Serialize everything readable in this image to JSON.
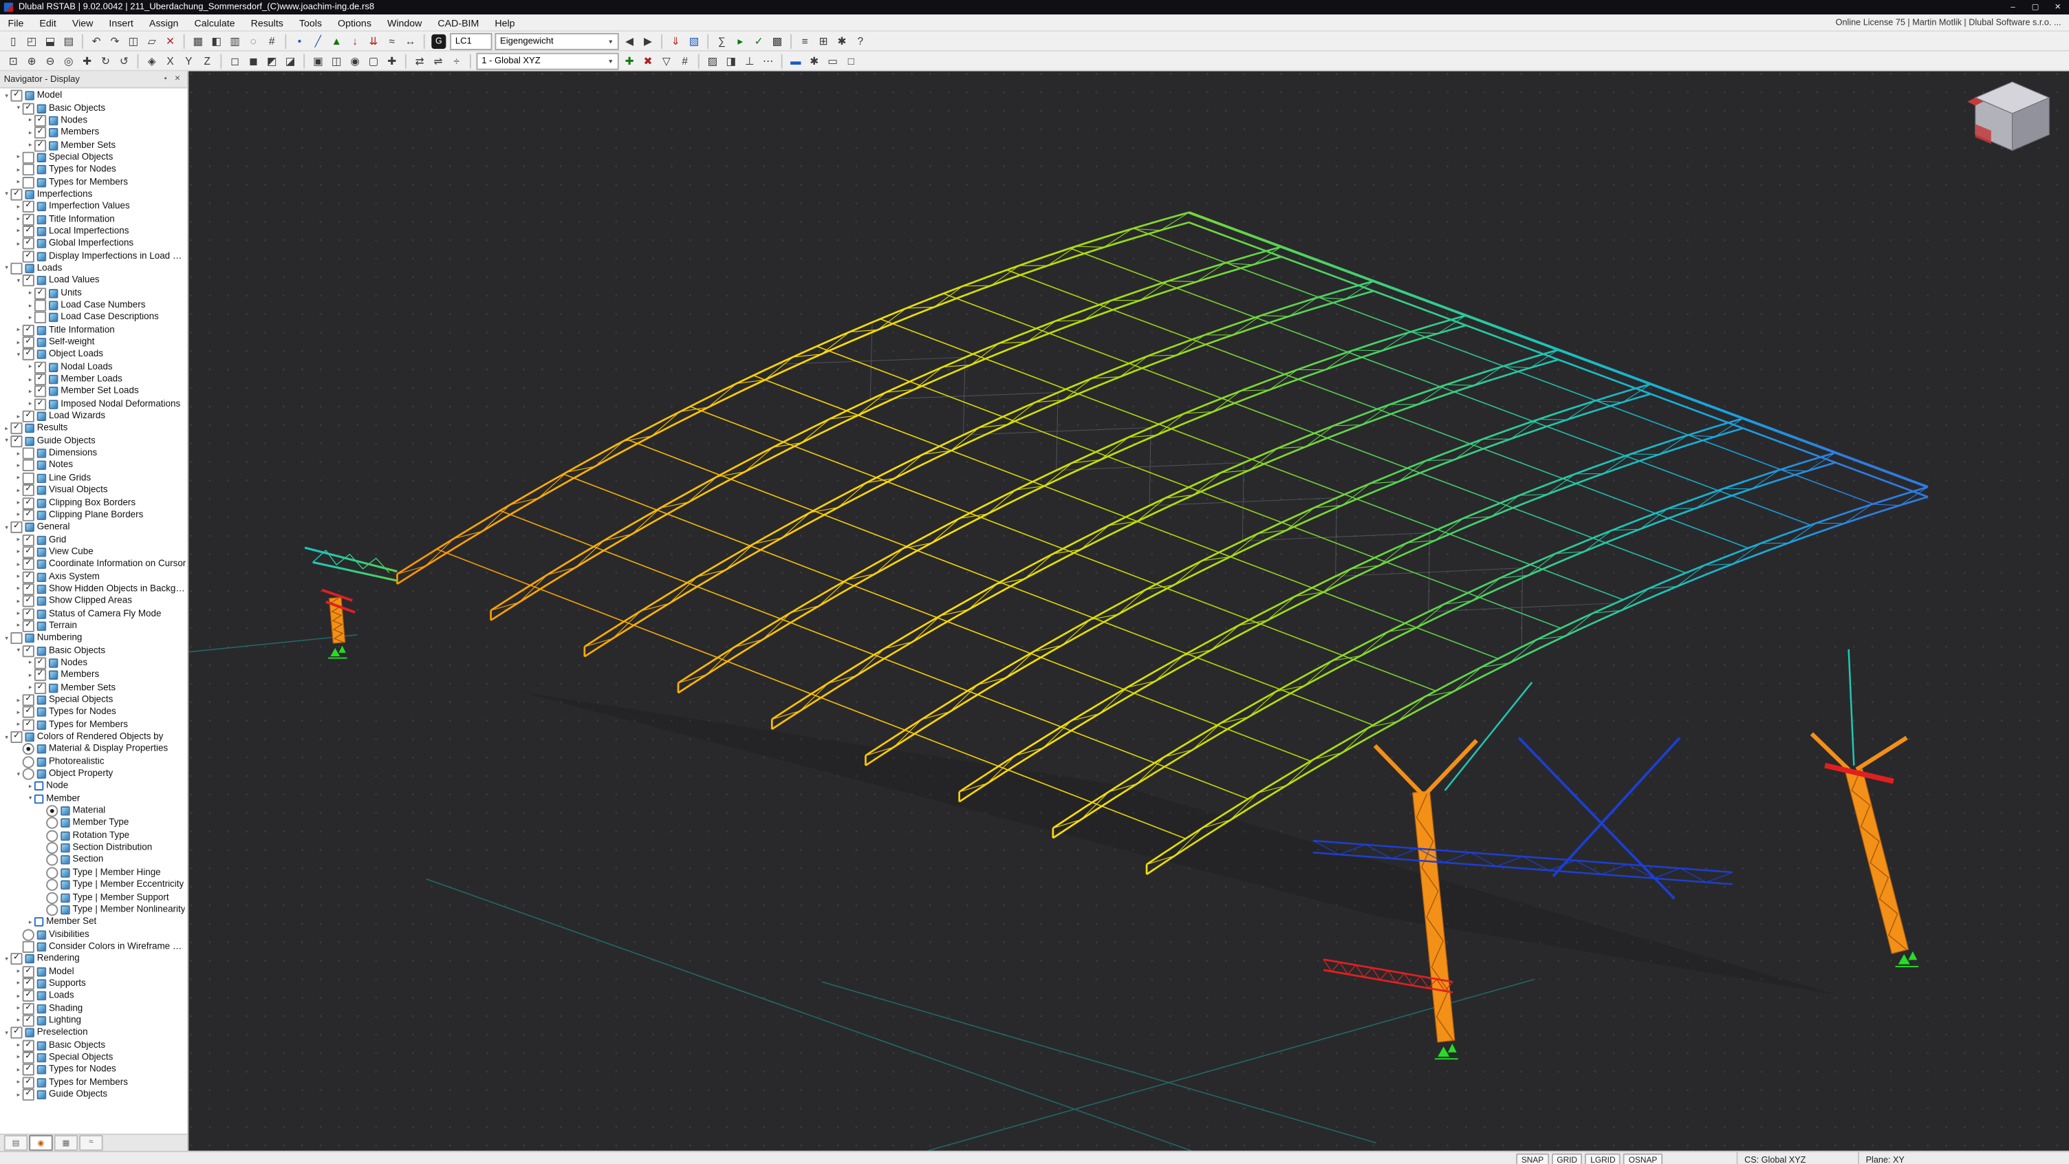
{
  "window": {
    "title": "Dlubal RSTAB | 9.02.0042 | 211_Überdachung_Sommersdorf_(C)www.joachim-ing.de.rs8",
    "controls": [
      {
        "name": "minimize-button",
        "glyph": "–"
      },
      {
        "name": "maximize-button",
        "glyph": "▢"
      },
      {
        "name": "close-button",
        "glyph": "✕"
      }
    ]
  },
  "menu": {
    "items": [
      "File",
      "Edit",
      "View",
      "Insert",
      "Assign",
      "Calculate",
      "Results",
      "Tools",
      "Options",
      "Window",
      "CAD-BIM",
      "Help"
    ],
    "license": "Online License 75 | Martin Motlik | Dlubal Software s.r.o. ..."
  },
  "toolbar1": {
    "icons_left": [
      {
        "n": "new-model-icon",
        "g": "▯"
      },
      {
        "n": "open-model-icon",
        "g": "◰"
      },
      {
        "n": "save-model-icon",
        "g": "⬓"
      },
      {
        "n": "print-icon",
        "g": "▤"
      },
      {
        "sep": true
      },
      {
        "n": "undo-icon",
        "g": "↶"
      },
      {
        "n": "redo-icon",
        "g": "↷"
      },
      {
        "n": "copy-icon",
        "g": "◫"
      },
      {
        "n": "paste-icon",
        "g": "▱"
      },
      {
        "n": "delete-icon",
        "g": "✕",
        "c": "#a82222"
      },
      {
        "sep": true
      },
      {
        "n": "edit-tables-icon",
        "g": "▦"
      },
      {
        "n": "navigator-toggle-icon",
        "g": "◧"
      },
      {
        "n": "tables-toggle-icon",
        "g": "▥"
      },
      {
        "n": "find-icon",
        "g": "◌"
      },
      {
        "n": "renumber-icon",
        "g": "#"
      },
      {
        "sep": true
      },
      {
        "n": "new-node-icon",
        "g": "•",
        "c": "#1a5ac8"
      },
      {
        "n": "new-member-icon",
        "g": "╱",
        "c": "#1a5ac8"
      },
      {
        "n": "new-support-icon",
        "g": "▲",
        "c": "#127812"
      },
      {
        "n": "new-nodal-load-icon",
        "g": "↓",
        "c": "#c01818"
      },
      {
        "n": "new-member-load-icon",
        "g": "⇊",
        "c": "#c01818"
      },
      {
        "n": "imperfection-icon",
        "g": "≈"
      },
      {
        "n": "dimension-icon",
        "g": "↔"
      },
      {
        "sep": true
      }
    ],
    "case_badge": "G",
    "case_number": "LC1",
    "case_description": "Eigengewicht",
    "chevron": "▼",
    "icons_right": [
      {
        "n": "previous-load-case-icon",
        "g": "◀"
      },
      {
        "n": "next-load-case-icon",
        "g": "▶"
      },
      {
        "sep": true
      },
      {
        "n": "show-loads-icon",
        "g": "⇓",
        "c": "#c01818"
      },
      {
        "n": "show-results-icon",
        "g": "▧",
        "c": "#1a5ac8"
      },
      {
        "sep": true
      },
      {
        "n": "calculate-all-icon",
        "g": "∑"
      },
      {
        "n": "run-calculation-icon",
        "g": "▸",
        "c": "#0a7a0a"
      },
      {
        "n": "check-model-icon",
        "g": "✓",
        "c": "#0a7a0a"
      },
      {
        "n": "mesh-icon",
        "g": "▩"
      },
      {
        "sep": true
      },
      {
        "n": "printout-report-icon",
        "g": "≡"
      },
      {
        "n": "export-icon",
        "g": "⊞"
      },
      {
        "n": "units-settings-icon",
        "g": "✱"
      },
      {
        "n": "help-icon",
        "g": "?"
      }
    ]
  },
  "toolbar2": {
    "icons_left": [
      {
        "n": "zoom-window-icon",
        "g": "⊡"
      },
      {
        "n": "zoom-in-icon",
        "g": "⊕"
      },
      {
        "n": "zoom-out-icon",
        "g": "⊖"
      },
      {
        "n": "zoom-all-icon",
        "g": "◎"
      },
      {
        "n": "pan-view-icon",
        "g": "✚"
      },
      {
        "n": "rotate-view-icon",
        "g": "↻"
      },
      {
        "n": "previous-view-icon",
        "g": "↺"
      },
      {
        "sep": true
      },
      {
        "n": "isometric-view-icon",
        "g": "◈"
      },
      {
        "n": "view-in-x-icon",
        "g": "X"
      },
      {
        "n": "view-in-y-icon",
        "g": "Y"
      },
      {
        "n": "view-in-z-icon",
        "g": "Z"
      },
      {
        "sep": true
      },
      {
        "n": "wireframe-display-icon",
        "g": "◻"
      },
      {
        "n": "solid-display-icon",
        "g": "◼"
      },
      {
        "n": "transparent-display-icon",
        "g": "◩"
      },
      {
        "n": "hidden-line-display-icon",
        "g": "◪"
      },
      {
        "sep": true
      },
      {
        "n": "clipping-box-icon",
        "g": "▣"
      },
      {
        "n": "clipping-plane-icon",
        "g": "◫"
      },
      {
        "n": "visibility-mode-icon",
        "g": "◉"
      },
      {
        "n": "select-objects-icon",
        "g": "▢"
      },
      {
        "n": "special-selection-icon",
        "g": "✚"
      },
      {
        "sep": true
      },
      {
        "n": "move-copy-icon",
        "g": "⇄"
      },
      {
        "n": "mirror-objects-icon",
        "g": "⇌"
      },
      {
        "n": "divide-member-icon",
        "g": "÷"
      },
      {
        "sep": true
      }
    ],
    "view_selector": "1 - Global XYZ",
    "chevron": "▼",
    "icons_right": [
      {
        "n": "new-visibility-icon",
        "g": "✚",
        "c": "#0a7a0a"
      },
      {
        "n": "cancel-selection-icon",
        "g": "✖",
        "c": "#a82222"
      },
      {
        "n": "filter-icon",
        "g": "▽"
      },
      {
        "n": "numbering-toggle-icon",
        "g": "#"
      },
      {
        "sep": true
      },
      {
        "n": "display-properties-icon",
        "g": "▨"
      },
      {
        "n": "background-icon",
        "g": "◨"
      },
      {
        "n": "axis-systems-icon",
        "g": "⊥"
      },
      {
        "n": "grid-settings-icon",
        "g": "⋯"
      },
      {
        "sep": true
      },
      {
        "n": "render-mode-icon",
        "g": "▬",
        "c": "#1a5ac8"
      },
      {
        "n": "light-settings-icon",
        "g": "✱"
      },
      {
        "n": "screenshot-icon",
        "g": "▭"
      },
      {
        "n": "full-screen-icon",
        "g": "□"
      }
    ]
  },
  "navigator": {
    "title": "Navigator - Display",
    "header_icons": [
      {
        "name": "dock-pin-icon",
        "glyph": "▪"
      },
      {
        "name": "close-navigator-icon",
        "glyph": "✕"
      }
    ],
    "items": [
      {
        "label": "Model",
        "depth": 0,
        "ctrl": "cb",
        "on": true,
        "exp": "o"
      },
      {
        "label": "Basic Objects",
        "depth": 1,
        "ctrl": "cb",
        "on": true,
        "exp": "o"
      },
      {
        "label": "Nodes",
        "depth": 2,
        "ctrl": "cb",
        "on": true,
        "exp": "c"
      },
      {
        "label": "Members",
        "depth": 2,
        "ctrl": "cb",
        "on": true,
        "exp": "c"
      },
      {
        "label": "Member Sets",
        "depth": 2,
        "ctrl": "cb",
        "on": true,
        "exp": "c"
      },
      {
        "label": "Special Objects",
        "depth": 1,
        "ctrl": "cb",
        "on": false,
        "exp": "c"
      },
      {
        "label": "Types for Nodes",
        "depth": 1,
        "ctrl": "cb",
        "on": false,
        "exp": "c"
      },
      {
        "label": "Types for Members",
        "depth": 1,
        "ctrl": "cb",
        "on": false,
        "exp": "c"
      },
      {
        "label": "Imperfections",
        "depth": 0,
        "ctrl": "cb",
        "on": true,
        "exp": "o"
      },
      {
        "label": "Imperfection Values",
        "depth": 1,
        "ctrl": "cb",
        "on": true,
        "exp": "c"
      },
      {
        "label": "Title Information",
        "depth": 1,
        "ctrl": "cb",
        "on": true,
        "exp": "c"
      },
      {
        "label": "Local Imperfections",
        "depth": 1,
        "ctrl": "cb",
        "on": true,
        "exp": "c"
      },
      {
        "label": "Global Imperfections",
        "depth": 1,
        "ctrl": "cb",
        "on": true,
        "exp": "c"
      },
      {
        "label": "Display Imperfections in Load Cas...",
        "depth": 1,
        "ctrl": "cb",
        "on": true,
        "exp": "-"
      },
      {
        "label": "Loads",
        "depth": 0,
        "ctrl": "cb",
        "on": false,
        "exp": "o"
      },
      {
        "label": "Load Values",
        "depth": 1,
        "ctrl": "cb",
        "on": true,
        "exp": "o"
      },
      {
        "label": "Units",
        "depth": 2,
        "ctrl": "cb",
        "on": true,
        "exp": "c"
      },
      {
        "label": "Load Case Numbers",
        "depth": 2,
        "ctrl": "cb",
        "on": false,
        "exp": "c"
      },
      {
        "label": "Load Case Descriptions",
        "depth": 2,
        "ctrl": "cb",
        "on": false,
        "exp": "c"
      },
      {
        "label": "Title Information",
        "depth": 1,
        "ctrl": "cb",
        "on": true,
        "exp": "c"
      },
      {
        "label": "Self-weight",
        "depth": 1,
        "ctrl": "cb",
        "on": true,
        "exp": "c"
      },
      {
        "label": "Object Loads",
        "depth": 1,
        "ctrl": "cb",
        "on": true,
        "exp": "o"
      },
      {
        "label": "Nodal Loads",
        "depth": 2,
        "ctrl": "cb",
        "on": true,
        "exp": "c"
      },
      {
        "label": "Member Loads",
        "depth": 2,
        "ctrl": "cb",
        "on": true,
        "exp": "c"
      },
      {
        "label": "Member Set Loads",
        "depth": 2,
        "ctrl": "cb",
        "on": true,
        "exp": "c"
      },
      {
        "label": "Imposed Nodal Deformations",
        "depth": 2,
        "ctrl": "cb",
        "on": true,
        "exp": "c"
      },
      {
        "label": "Load Wizards",
        "depth": 1,
        "ctrl": "cb",
        "on": true,
        "exp": "c"
      },
      {
        "label": "Results",
        "depth": 0,
        "ctrl": "cb",
        "on": true,
        "exp": "c"
      },
      {
        "label": "Guide Objects",
        "depth": 0,
        "ctrl": "cb",
        "on": true,
        "exp": "o"
      },
      {
        "label": "Dimensions",
        "depth": 1,
        "ctrl": "cb",
        "on": false,
        "exp": "c"
      },
      {
        "label": "Notes",
        "depth": 1,
        "ctrl": "cb",
        "on": false,
        "exp": "c"
      },
      {
        "label": "Line Grids",
        "depth": 1,
        "ctrl": "cb",
        "on": false,
        "exp": "c"
      },
      {
        "label": "Visual Objects",
        "depth": 1,
        "ctrl": "cb",
        "on": true,
        "exp": "c"
      },
      {
        "label": "Clipping Box Borders",
        "depth": 1,
        "ctrl": "cb",
        "on": true,
        "exp": "c"
      },
      {
        "label": "Clipping Plane Borders",
        "depth": 1,
        "ctrl": "cb",
        "on": true,
        "exp": "c"
      },
      {
        "label": "General",
        "depth": 0,
        "ctrl": "cb",
        "on": true,
        "exp": "o"
      },
      {
        "label": "Grid",
        "depth": 1,
        "ctrl": "cb",
        "on": true,
        "exp": "c"
      },
      {
        "label": "View Cube",
        "depth": 1,
        "ctrl": "cb",
        "on": true,
        "exp": "c"
      },
      {
        "label": "Coordinate Information on Cursor",
        "depth": 1,
        "ctrl": "cb",
        "on": true,
        "exp": "c"
      },
      {
        "label": "Axis System",
        "depth": 1,
        "ctrl": "cb",
        "on": true,
        "exp": "c"
      },
      {
        "label": "Show Hidden Objects in Backgro...",
        "depth": 1,
        "ctrl": "cb",
        "on": true,
        "exp": "c"
      },
      {
        "label": "Show Clipped Areas",
        "depth": 1,
        "ctrl": "cb",
        "on": true,
        "exp": "c"
      },
      {
        "label": "Status of Camera Fly Mode",
        "depth": 1,
        "ctrl": "cb",
        "on": true,
        "exp": "c"
      },
      {
        "label": "Terrain",
        "depth": 1,
        "ctrl": "cb",
        "on": true,
        "exp": "c"
      },
      {
        "label": "Numbering",
        "depth": 0,
        "ctrl": "cb",
        "on": false,
        "exp": "o"
      },
      {
        "label": "Basic Objects",
        "depth": 1,
        "ctrl": "cb",
        "on": true,
        "exp": "o"
      },
      {
        "label": "Nodes",
        "depth": 2,
        "ctrl": "cb",
        "on": true,
        "exp": "c"
      },
      {
        "label": "Members",
        "depth": 2,
        "ctrl": "cb",
        "on": true,
        "exp": "c"
      },
      {
        "label": "Member Sets",
        "depth": 2,
        "ctrl": "cb",
        "on": true,
        "exp": "c"
      },
      {
        "label": "Special Objects",
        "depth": 1,
        "ctrl": "cb",
        "on": true,
        "exp": "c"
      },
      {
        "label": "Types for Nodes",
        "depth": 1,
        "ctrl": "cb",
        "on": true,
        "exp": "c"
      },
      {
        "label": "Types for Members",
        "depth": 1,
        "ctrl": "cb",
        "on": true,
        "exp": "c"
      },
      {
        "label": "Colors of Rendered Objects by",
        "depth": 0,
        "ctrl": "cb",
        "on": true,
        "exp": "o"
      },
      {
        "label": "Material & Display Properties",
        "depth": 1,
        "ctrl": "rb",
        "on": true,
        "exp": "-"
      },
      {
        "label": "Photorealistic",
        "depth": 1,
        "ctrl": "rb",
        "on": false,
        "exp": "-"
      },
      {
        "label": "Object Property",
        "depth": 1,
        "ctrl": "rb",
        "on": false,
        "exp": "o"
      },
      {
        "label": "Node",
        "depth": 2,
        "ctrl": "none",
        "on": false,
        "exp": "c",
        "swatch": true
      },
      {
        "label": "Member",
        "depth": 2,
        "ctrl": "none",
        "on": false,
        "exp": "o",
        "swatch": true
      },
      {
        "label": "Material",
        "depth": 3,
        "ctrl": "rb",
        "on": true,
        "exp": "-"
      },
      {
        "label": "Member Type",
        "depth": 3,
        "ctrl": "rb",
        "on": false,
        "exp": "-"
      },
      {
        "label": "Rotation Type",
        "depth": 3,
        "ctrl": "rb",
        "on": false,
        "exp": "-"
      },
      {
        "label": "Section Distribution",
        "depth": 3,
        "ctrl": "rb",
        "on": false,
        "exp": "-"
      },
      {
        "label": "Section",
        "depth": 3,
        "ctrl": "rb",
        "on": false,
        "exp": "-"
      },
      {
        "label": "Type | Member Hinge",
        "depth": 3,
        "ctrl": "rb",
        "on": false,
        "exp": "-"
      },
      {
        "label": "Type | Member Eccentricity",
        "depth": 3,
        "ctrl": "rb",
        "on": false,
        "exp": "-"
      },
      {
        "label": "Type | Member Support",
        "depth": 3,
        "ctrl": "rb",
        "on": false,
        "exp": "-"
      },
      {
        "label": "Type | Member Nonlinearity",
        "depth": 3,
        "ctrl": "rb",
        "on": false,
        "exp": "-"
      },
      {
        "label": "Member Set",
        "depth": 2,
        "ctrl": "none",
        "on": false,
        "exp": "c",
        "swatch": true
      },
      {
        "label": "Visibilities",
        "depth": 1,
        "ctrl": "rb",
        "on": false,
        "exp": "-"
      },
      {
        "label": "Consider Colors in Wireframe Mo...",
        "depth": 1,
        "ctrl": "cb",
        "on": false,
        "exp": "-"
      },
      {
        "label": "Rendering",
        "depth": 0,
        "ctrl": "cb",
        "on": true,
        "exp": "o"
      },
      {
        "label": "Model",
        "depth": 1,
        "ctrl": "cb",
        "on": true,
        "exp": "c"
      },
      {
        "label": "Supports",
        "depth": 1,
        "ctrl": "cb",
        "on": true,
        "exp": "c"
      },
      {
        "label": "Loads",
        "depth": 1,
        "ctrl": "cb",
        "on": true,
        "exp": "c"
      },
      {
        "label": "Shading",
        "depth": 1,
        "ctrl": "cb",
        "on": true,
        "exp": "c"
      },
      {
        "label": "Lighting",
        "depth": 1,
        "ctrl": "cb",
        "on": true,
        "exp": "c"
      },
      {
        "label": "Preselection",
        "depth": 0,
        "ctrl": "cb",
        "on": true,
        "exp": "o"
      },
      {
        "label": "Basic Objects",
        "depth": 1,
        "ctrl": "cb",
        "on": true,
        "exp": "c"
      },
      {
        "label": "Special Objects",
        "depth": 1,
        "ctrl": "cb",
        "on": true,
        "exp": "c"
      },
      {
        "label": "Types for Nodes",
        "depth": 1,
        "ctrl": "cb",
        "on": true,
        "exp": "c"
      },
      {
        "label": "Types for Members",
        "depth": 1,
        "ctrl": "cb",
        "on": true,
        "exp": "c"
      },
      {
        "label": "Guide Objects",
        "depth": 1,
        "ctrl": "cb",
        "on": true,
        "exp": "c"
      }
    ],
    "tabs": [
      {
        "name": "data-tab",
        "glyph": "▤",
        "active": false
      },
      {
        "name": "display-tab",
        "glyph": "◉",
        "active": true
      },
      {
        "name": "views-tab",
        "glyph": "▦",
        "active": false
      },
      {
        "name": "results-tab",
        "glyph": "≈",
        "active": false
      }
    ]
  },
  "viewport": {
    "bg": "#29292c",
    "grid_dot": "#3c3c41",
    "guide_line": "#1f8080",
    "result_gradient": [
      {
        "offset": 0.0,
        "color": "#ff8400"
      },
      {
        "offset": 0.2,
        "color": "#ffb000"
      },
      {
        "offset": 0.42,
        "color": "#ffe000"
      },
      {
        "offset": 0.58,
        "color": "#b4e000"
      },
      {
        "offset": 0.72,
        "color": "#54d455"
      },
      {
        "offset": 0.84,
        "color": "#1cc8b2"
      },
      {
        "offset": 0.93,
        "color": "#17a8dc"
      },
      {
        "offset": 1.0,
        "color": "#2e7ce2"
      }
    ],
    "tip_gradient": [
      "#16c8c8",
      "#4ad05e",
      "#ffc400"
    ],
    "column_color": "#f29018",
    "column_edge": "#b35f07",
    "support_color": "#25dd25",
    "beam_blue": "#1c3fd4",
    "beam_red": "#e02020",
    "tie_teal": "#1fc9b2",
    "cube": {
      "top": "#d4d4da",
      "left": "#b2b2ba",
      "right": "#92929c",
      "edge": "#70707a",
      "accent": "#c23c3c"
    }
  },
  "statusbar": {
    "toggles": [
      {
        "label": "SNAP",
        "active": true
      },
      {
        "label": "GRID",
        "active": true
      },
      {
        "label": "LGRID",
        "active": true
      },
      {
        "label": "OSNAP",
        "active": true
      }
    ],
    "cs_label": "CS: Global XYZ",
    "plane_label": "Plane: XY"
  }
}
